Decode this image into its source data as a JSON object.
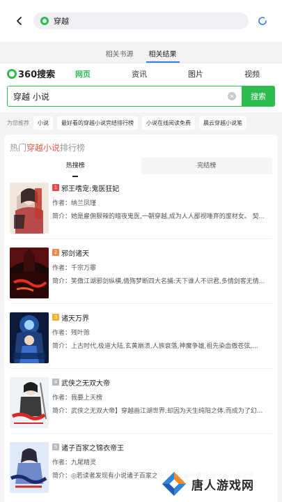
{
  "topbar": {
    "query": "穿越"
  },
  "source_tabs": [
    {
      "label": "相关书源"
    },
    {
      "label": "相关结果"
    }
  ],
  "so_header": {
    "logo": "360搜索",
    "nav": [
      "网页",
      "资讯",
      "图片",
      "视频"
    ]
  },
  "query": {
    "value": "穿越 小说",
    "button": "搜索"
  },
  "recommend": {
    "label": "为您推荐",
    "chips": [
      "小说",
      "最好看的穿越小说完结排行榜",
      "小说在线阅读免费",
      "晨云穿越小说笔"
    ]
  },
  "ranking": {
    "title_prefix": "热门",
    "title_highlight": "穿越小说",
    "title_suffix": "排行榜",
    "tabs": [
      "热搜榜",
      "完结榜"
    ],
    "items": [
      {
        "rank": "1",
        "name": "邪王嗜宠:鬼医狂妃",
        "author": "作者：纳兰凤瑾",
        "intro": "简介：她是雇佣狠辣的暗夜鬼医,一朝穿越,成为人人鄙视唾弃的废材女。 契..."
      },
      {
        "rank": "2",
        "name": "邪剑诸天",
        "author": "作者：千宗万罪",
        "intro": "简介：笑傲江湖邪剑纵横,倩殇梦断四大名捕:天下谁人不识君,多情剑客无情..."
      },
      {
        "rank": "3",
        "name": "诸天万界",
        "author": "作者：残叶赊",
        "intro": "简介：上古时代,极道大陆,玄黄崩溃,人族衰落,神魔争雄,祖先染血傲苍弦,..."
      },
      {
        "rank": "4",
        "name": "武侠之无双大帝",
        "author": "作者：我要上天榜",
        "intro": "简介：武侠之无双大帝】穿越画江湖世界,却因为天生纯阳之体,而成为了幻..."
      },
      {
        "rank": "5",
        "name": "诸子百家之锦衣帝王",
        "author": "作者：九尾精灵",
        "intro": "简介：◎若读者发现有小说诸子百家之锦衣帝王最新章节,而飞卢小说又没..."
      }
    ]
  },
  "watermark": {
    "text": "唐人游戏网"
  }
}
